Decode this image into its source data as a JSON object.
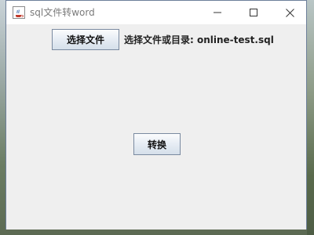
{
  "window": {
    "title": "sql文件转word"
  },
  "controls": {
    "minimize": "minimize",
    "maximize": "maximize",
    "close": "close"
  },
  "main": {
    "choose_button_label": "选择文件",
    "path_label": "选择文件或目录: online-test.sql",
    "convert_button_label": "转换"
  },
  "colors": {
    "window_bg": "#efefef",
    "titlebar_bg": "#ffffff",
    "border": "#6d7f9a"
  },
  "icons": {
    "app": "java-coffee-cup-icon"
  }
}
